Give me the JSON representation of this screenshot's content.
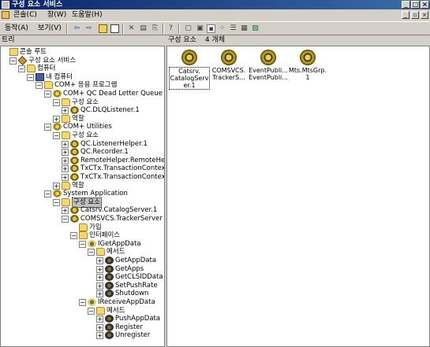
{
  "window": {
    "title": "구성 요소 서비스"
  },
  "menu": {
    "items": [
      "콘솔(C)",
      "창(W)",
      "도움말(H)"
    ]
  },
  "toolbar": {
    "action_label": "동작(A)",
    "view_label": "보기(V)"
  },
  "tree_header": {
    "label": "트리"
  },
  "list_header": {
    "title": "구성 요소",
    "count": "4 개체"
  },
  "tree": [
    {
      "label": "콘솔 루트",
      "level": 0,
      "icon": "root",
      "exp": ""
    },
    {
      "label": "구성 요소 서비스",
      "level": 1,
      "icon": "service",
      "exp": "-"
    },
    {
      "label": "컴퓨터",
      "level": 2,
      "icon": "folder",
      "exp": "-"
    },
    {
      "label": "내 컴퓨터",
      "level": 3,
      "icon": "comp",
      "exp": "-"
    },
    {
      "label": "COM+ 응용 프로그램",
      "level": 4,
      "icon": "folder",
      "exp": "-"
    },
    {
      "label": "COM+ QC Dead Letter Queue Listene",
      "level": 5,
      "icon": "gear",
      "exp": "-"
    },
    {
      "label": "구성 요소",
      "level": 6,
      "icon": "folder",
      "exp": "-"
    },
    {
      "label": "QC.DLQListener.1",
      "level": 7,
      "icon": "comp-ico",
      "exp": "+"
    },
    {
      "label": "역할",
      "level": 6,
      "icon": "folder",
      "exp": "+"
    },
    {
      "label": "COM+ Utilities",
      "level": 5,
      "icon": "gear",
      "exp": "-"
    },
    {
      "label": "구성 요소",
      "level": 6,
      "icon": "folder",
      "exp": "-"
    },
    {
      "label": "QC.ListenerHelper.1",
      "level": 7,
      "icon": "comp-ico",
      "exp": "+"
    },
    {
      "label": "QC.Recorder.1",
      "level": 7,
      "icon": "comp-ico",
      "exp": "+"
    },
    {
      "label": "RemoteHelper.RemoteHelper",
      "level": 7,
      "icon": "comp-ico",
      "exp": "+"
    },
    {
      "label": "TxCTx.TransactionContext",
      "level": 7,
      "icon": "comp-ico",
      "exp": "+"
    },
    {
      "label": "TxCTx.TransactionContextEx",
      "level": 7,
      "icon": "comp-ico",
      "exp": "+"
    },
    {
      "label": "역할",
      "level": 6,
      "icon": "folder",
      "exp": "+"
    },
    {
      "label": "System Application",
      "level": 5,
      "icon": "gear",
      "exp": "-"
    },
    {
      "label": "구성 요소",
      "level": 6,
      "icon": "folder",
      "exp": "-",
      "selected": true
    },
    {
      "label": "Catsrv.CatalogServer.1",
      "level": 7,
      "icon": "comp-ico",
      "exp": "+"
    },
    {
      "label": "COMSVCS.TrackerServer",
      "level": 7,
      "icon": "comp-ico",
      "exp": "-"
    },
    {
      "label": "가입",
      "level": 8,
      "icon": "folder",
      "exp": ""
    },
    {
      "label": "인터페이스",
      "level": 8,
      "icon": "folder",
      "exp": "-"
    },
    {
      "label": "IGetAppData",
      "level": 9,
      "icon": "iface",
      "exp": "-"
    },
    {
      "label": "메서드",
      "level": 10,
      "icon": "folder",
      "exp": "-"
    },
    {
      "label": "GetAppData",
      "level": 11,
      "icon": "method",
      "exp": "+"
    },
    {
      "label": "GetApps",
      "level": 11,
      "icon": "method",
      "exp": "+"
    },
    {
      "label": "GetCLSIDData",
      "level": 11,
      "icon": "method",
      "exp": "+"
    },
    {
      "label": "SetPushRate",
      "level": 11,
      "icon": "method",
      "exp": "+"
    },
    {
      "label": "Shutdown",
      "level": 11,
      "icon": "method",
      "exp": "+"
    },
    {
      "label": "IReceiveAppData",
      "level": 9,
      "icon": "iface",
      "exp": "-"
    },
    {
      "label": "메서드",
      "level": 10,
      "icon": "folder",
      "exp": "-"
    },
    {
      "label": "PushAppData",
      "level": 11,
      "icon": "method",
      "exp": "+"
    },
    {
      "label": "Register",
      "level": 11,
      "icon": "method",
      "exp": "+"
    },
    {
      "label": "Unregister",
      "level": 11,
      "icon": "method",
      "exp": "+"
    }
  ],
  "items": [
    {
      "label": "Catsrv.CatalogServer.1",
      "display": "Catsrv.\nCatalogServ\ner.1",
      "selected": true
    },
    {
      "label": "COMSVCS.TrackerS...",
      "display": "COMSVCS.\nTrackerS...",
      "selected": false
    },
    {
      "label": "EventPubli...",
      "display": "EventPubli...\nEventPubli...",
      "selected": false
    },
    {
      "label": "Mts.MtsGrp.1",
      "display": "Mts.MtsGrp.\n1",
      "selected": false
    }
  ]
}
